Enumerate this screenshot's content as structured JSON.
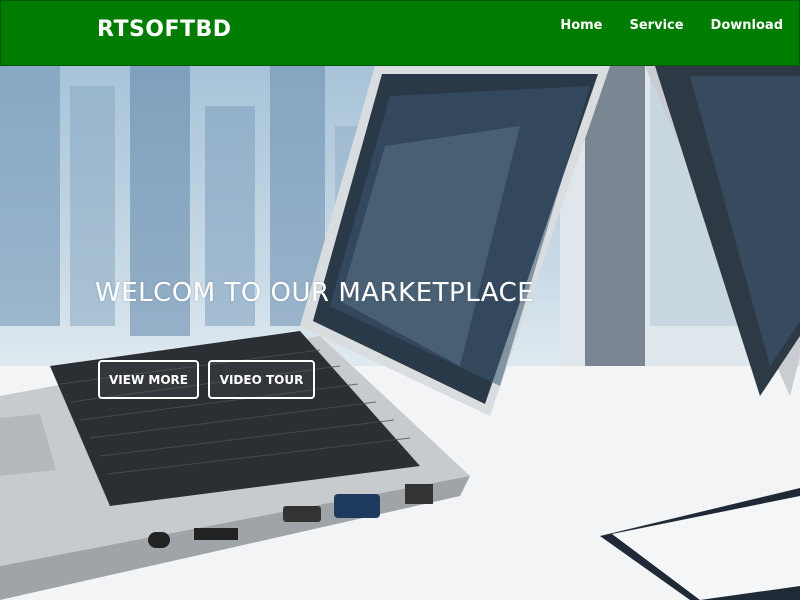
{
  "header": {
    "brand": "RTSOFTBD",
    "nav": [
      "Home",
      "Service",
      "Download"
    ]
  },
  "hero": {
    "title": "WELCOM TO OUR MARKETPLACE",
    "buttons": [
      "VIEW MORE",
      "VIDEO TOUR"
    ]
  },
  "colors": {
    "header_bg": "#007c00",
    "text": "#ffffff"
  }
}
